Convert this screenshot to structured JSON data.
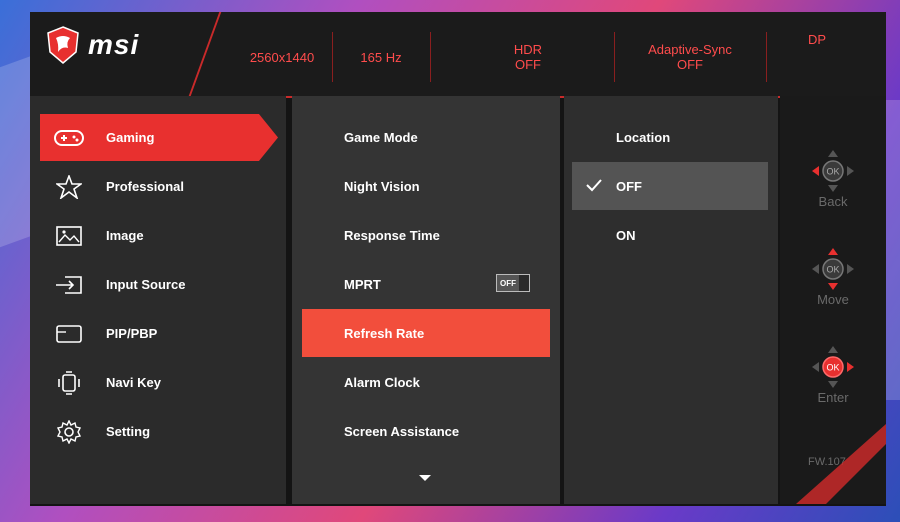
{
  "brand": {
    "name": "msi"
  },
  "status": {
    "resolution": "2560x1440",
    "refresh": "165 Hz",
    "hdr_label": "HDR",
    "hdr_value": "OFF",
    "adaptive_label": "Adaptive-Sync",
    "adaptive_value": "OFF",
    "input": "DP"
  },
  "menu": [
    {
      "label": "Gaming",
      "icon": "gamepad-icon"
    },
    {
      "label": "Professional",
      "icon": "star-icon"
    },
    {
      "label": "Image",
      "icon": "image-icon"
    },
    {
      "label": "Input Source",
      "icon": "input-source-icon"
    },
    {
      "label": "PIP/PBP",
      "icon": "pip-icon"
    },
    {
      "label": "Navi Key",
      "icon": "navi-key-icon"
    },
    {
      "label": "Setting",
      "icon": "gear-icon"
    }
  ],
  "submenu": [
    {
      "label": "Game Mode"
    },
    {
      "label": "Night Vision"
    },
    {
      "label": "Response Time"
    },
    {
      "label": "MPRT",
      "toggle": "OFF"
    },
    {
      "label": "Refresh Rate"
    },
    {
      "label": "Alarm Clock"
    },
    {
      "label": "Screen Assistance"
    }
  ],
  "options": {
    "header": "Location",
    "items": [
      {
        "label": "OFF"
      },
      {
        "label": "ON"
      }
    ]
  },
  "keys": {
    "back": "Back",
    "move": "Move",
    "enter": "Enter",
    "ok": "OK"
  },
  "firmware": "FW.107",
  "colors": {
    "accent": "#e8302f",
    "header_text": "#ff4c4c",
    "selected_submenu": "#f24e3c"
  }
}
